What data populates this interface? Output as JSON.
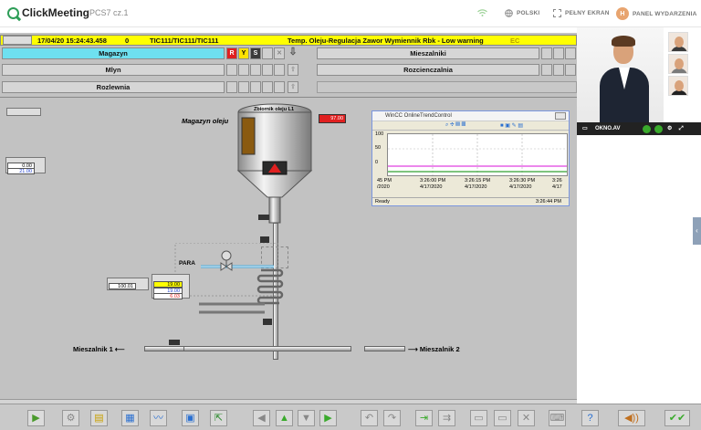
{
  "topbar": {
    "brand": "ClickMeeting",
    "room": "PCS7 cz.1",
    "lang": "POLSKI",
    "fullscreen": "PEŁNY EKRAN",
    "avatar_initial": "H",
    "panel": "PANEL WYDARZENIA"
  },
  "alarm": {
    "date_time": "17/04/20  15:24:43.458",
    "code": "0",
    "tag": "TIC111/TIC111/TIC111",
    "message": "Temp. Oleju-Regulacja Zawor Wymiennik Rbk - Low warning",
    "badge": "EC"
  },
  "nav": {
    "magazyn": "Magazyn",
    "mlyn": "Mlyn",
    "rozlewnia": "Rozlewnia",
    "mieszalniki": "Mieszalniki",
    "rozcienczalnia": "Rozcienczalnia",
    "btn_r": "R",
    "btn_y": "Y",
    "btn_s": "S"
  },
  "process": {
    "magazyn_oleju": "Magazyn oleju",
    "tank_title": "Zbiornik oleju L1",
    "tank_level": "97.00",
    "para": "PARA",
    "left_val_top": "0.00",
    "left_val_bottom": "21.00",
    "pump_val": "100.01",
    "ctl_val1": "19.00",
    "ctl_val2": "19.00",
    "ctl_val3": "6.03",
    "mieszalnik1": "Mieszalnik 1",
    "mieszalnik2": "Mieszalnik 2"
  },
  "trend": {
    "title": "WinCC OnlineTrendControl",
    "y_ticks": [
      "100",
      "50",
      "0"
    ],
    "x_labels": [
      {
        "time": "45 PM",
        "date": "/2020"
      },
      {
        "time": "3:26:00 PM",
        "date": "4/17/2020"
      },
      {
        "time": "3:26:15 PM",
        "date": "4/17/2020"
      },
      {
        "time": "3:26:30 PM",
        "date": "4/17/2020"
      },
      {
        "time": "3:26",
        "date": "4/17"
      }
    ],
    "status": "Ready",
    "clock": "3:26:44 PM"
  },
  "video": {
    "label": "OKNO.AV"
  },
  "colors": {
    "alarm_bg": "#ffff00",
    "scada_bg": "#c2c2c2",
    "active_nav": "#6ee0f0",
    "brand_green": "#2e9e58"
  }
}
